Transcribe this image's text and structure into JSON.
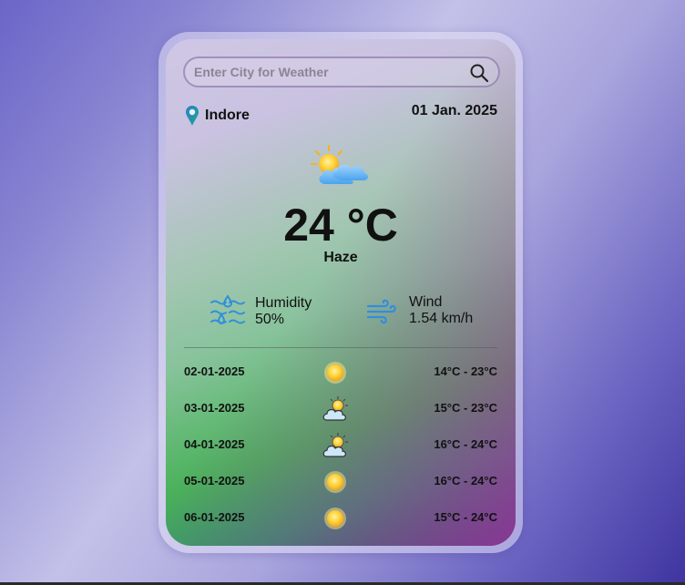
{
  "search": {
    "placeholder": "Enter City for Weather",
    "value": "",
    "button_icon": "search-icon"
  },
  "location": {
    "icon": "location-pin-icon",
    "city": "Indore"
  },
  "date": "01 Jan. 2025",
  "current": {
    "icon": "sun-behind-cloud-icon",
    "temperature": "24 °C",
    "condition": "Haze"
  },
  "stats": {
    "humidity": {
      "icon": "humidity-icon",
      "label": "Humidity",
      "value": "50%"
    },
    "wind": {
      "icon": "wind-icon",
      "label": "Wind",
      "value": "1.54 km/h"
    }
  },
  "forecast": [
    {
      "date": "02-01-2025",
      "icon": "sun-icon",
      "range": "14°C - 23°C"
    },
    {
      "date": "03-01-2025",
      "icon": "sun-behind-cloud-icon",
      "range": "15°C - 23°C"
    },
    {
      "date": "04-01-2025",
      "icon": "sun-behind-cloud-icon",
      "range": "16°C - 24°C"
    },
    {
      "date": "05-01-2025",
      "icon": "sun-icon",
      "range": "16°C - 24°C"
    },
    {
      "date": "06-01-2025",
      "icon": "sun-icon",
      "range": "15°C - 24°C"
    }
  ],
  "colors": {
    "background": "#8a86d2",
    "card_green": "#49b25a",
    "card_magenta": "#af28a5",
    "icon_blue": "#2f8fdc"
  }
}
